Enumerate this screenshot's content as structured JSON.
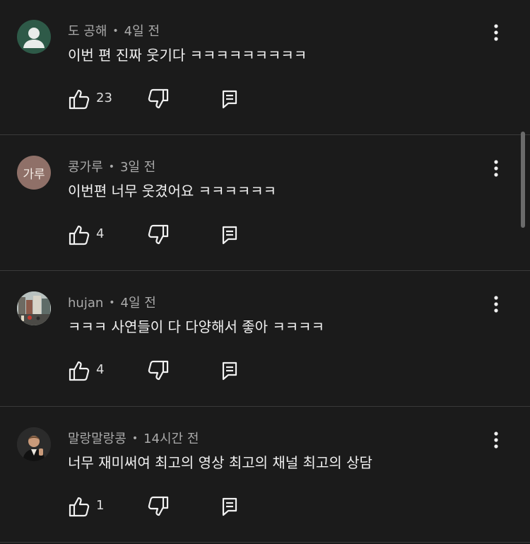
{
  "comments": [
    {
      "author": "도 공해",
      "time": "4일 전",
      "text": "이번 편 진짜 웃기다 ㅋㅋㅋㅋㅋㅋㅋㅋㅋ",
      "likes": "23",
      "avatar": {
        "type": "person-silhouette-icon",
        "color": "#2e5a48"
      }
    },
    {
      "author": "콩가루",
      "time": "3일 전",
      "text": "이번편 너무 웃겼어요 ㅋㅋㅋㅋㅋㅋ",
      "likes": "4",
      "avatar": {
        "type": "initials",
        "initials": "가루",
        "color": "#8f7068"
      }
    },
    {
      "author": "hujan",
      "time": "4일 전",
      "text": "ㅋㅋㅋ 사연들이 다 다양해서 좋아 ㅋㅋㅋㅋ",
      "likes": "4",
      "avatar": {
        "type": "photo-street",
        "color": "#9aa39a"
      }
    },
    {
      "author": "말랑말랑콩",
      "time": "14시간 전",
      "text": "너무 재미써여 최고의 영상 최고의 채널 최고의 상담",
      "likes": "1",
      "avatar": {
        "type": "photo-person",
        "color": "#2b2b2b"
      }
    }
  ],
  "meta_separator": "•",
  "colors": {
    "background": "#1b1b1b",
    "divider": "#3a3a3a",
    "meta_text": "#aaaaaa",
    "body_text": "#f1f1f1"
  }
}
